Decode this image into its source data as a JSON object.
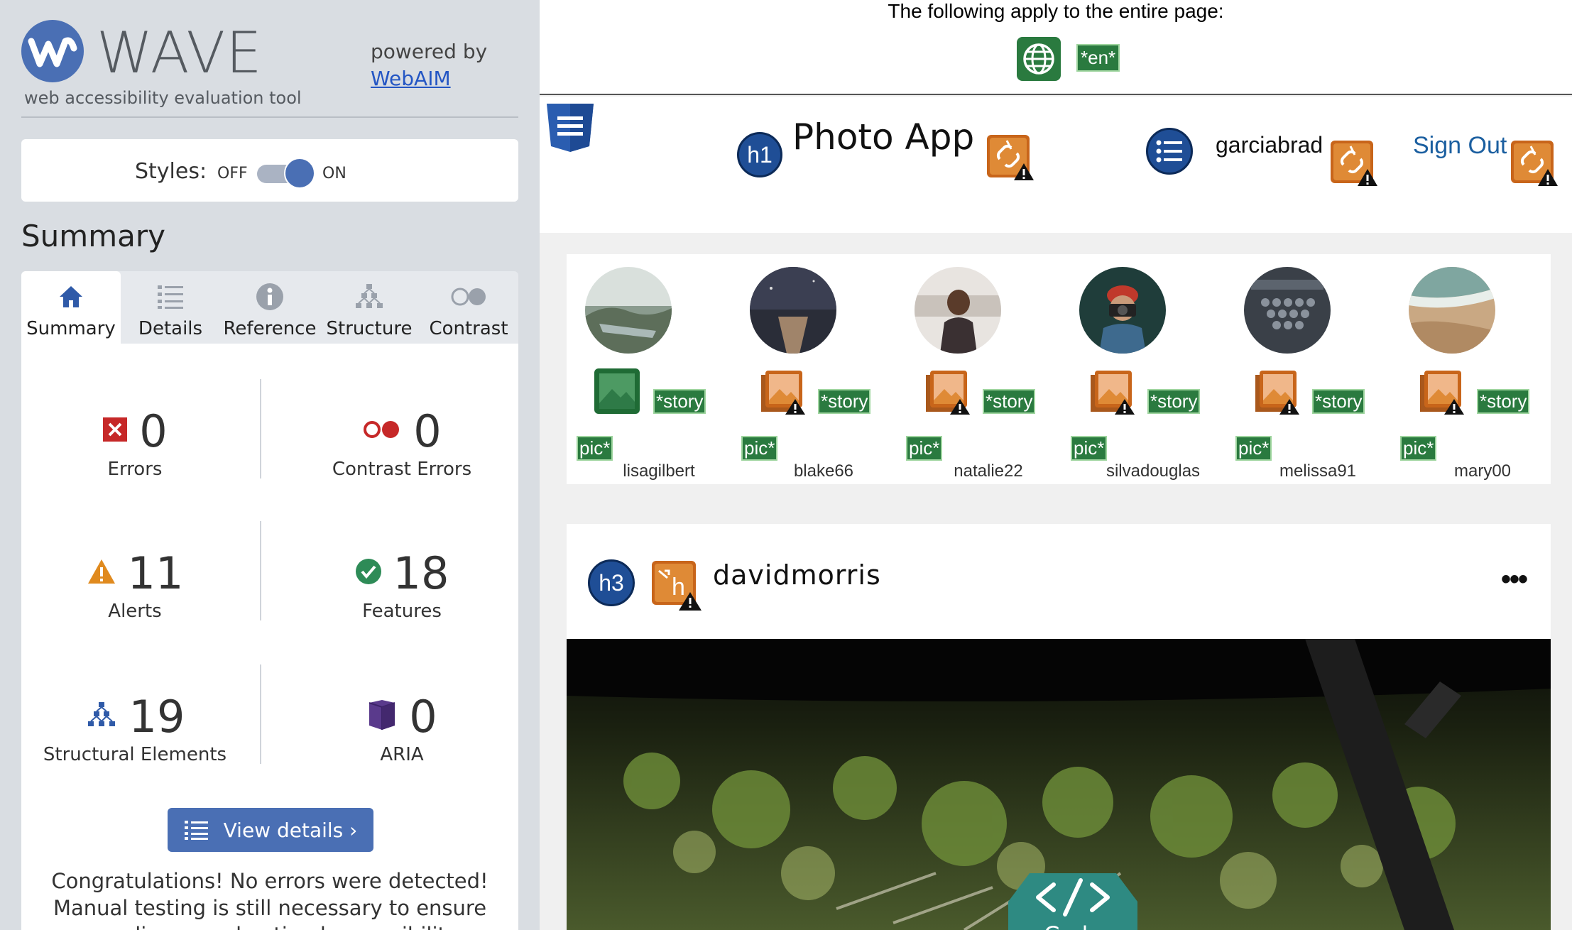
{
  "wave": {
    "logo_text": "WAVE",
    "tagline": "web accessibility evaluation tool",
    "powered_by": "powered by",
    "webaim_link": "WebAIM",
    "styles_label": "Styles:",
    "styles_off": "OFF",
    "styles_on": "ON",
    "summary_heading": "Summary",
    "tabs": [
      {
        "label": "Summary",
        "icon": "home-icon",
        "active": true
      },
      {
        "label": "Details",
        "icon": "list-icon",
        "active": false
      },
      {
        "label": "Reference",
        "icon": "info-icon",
        "active": false
      },
      {
        "label": "Structure",
        "icon": "hierarchy-icon",
        "active": false
      },
      {
        "label": "Contrast",
        "icon": "contrast-icon",
        "active": false
      }
    ],
    "stats": {
      "errors": {
        "count": "0",
        "label": "Errors"
      },
      "contrast_errors": {
        "count": "0",
        "label": "Contrast Errors"
      },
      "alerts": {
        "count": "11",
        "label": "Alerts"
      },
      "features": {
        "count": "18",
        "label": "Features"
      },
      "structural": {
        "count": "19",
        "label": "Structural Elements"
      },
      "aria": {
        "count": "0",
        "label": "ARIA"
      }
    },
    "view_details_label": "View details ›",
    "congrats_text": "Congratulations! No errors were detected! Manual testing is still necessary to ensure compliance and optimal accessibility."
  },
  "page": {
    "notice": "The following apply to the entire page:",
    "lang_badge": "*en*",
    "app_title": "Photo App",
    "h1_badge": "h1",
    "nav_username": "garciabrad",
    "sign_out": "Sign Out",
    "stories": [
      {
        "name": "lisagilbert",
        "story_tag": "*story",
        "pic_tag": "pic*",
        "icon": "image-feature-icon"
      },
      {
        "name": "blake66",
        "story_tag": "*story",
        "pic_tag": "pic*",
        "icon": "image-alert-icon"
      },
      {
        "name": "natalie22",
        "story_tag": "*story",
        "pic_tag": "pic*",
        "icon": "image-alert-icon"
      },
      {
        "name": "silvadouglas",
        "story_tag": "*story",
        "pic_tag": "pic*",
        "icon": "image-alert-icon"
      },
      {
        "name": "melissa91",
        "story_tag": "*story",
        "pic_tag": "pic*",
        "icon": "image-alert-icon"
      },
      {
        "name": "mary00",
        "story_tag": "*story",
        "pic_tag": "pic*",
        "icon": "image-alert-icon"
      }
    ],
    "post": {
      "h3_badge": "h3",
      "h_icon_letter": "h",
      "username": "davidmorris",
      "more": "•••",
      "code_label": "Code"
    }
  },
  "colors": {
    "wave_blue": "#4a6fb4",
    "feature_green": "#2a7a3f",
    "alert_orange": "#d07a2a",
    "error_red": "#c62828",
    "structure_blue": "#1f4e96",
    "aria_purple": "#5a3a8c"
  }
}
